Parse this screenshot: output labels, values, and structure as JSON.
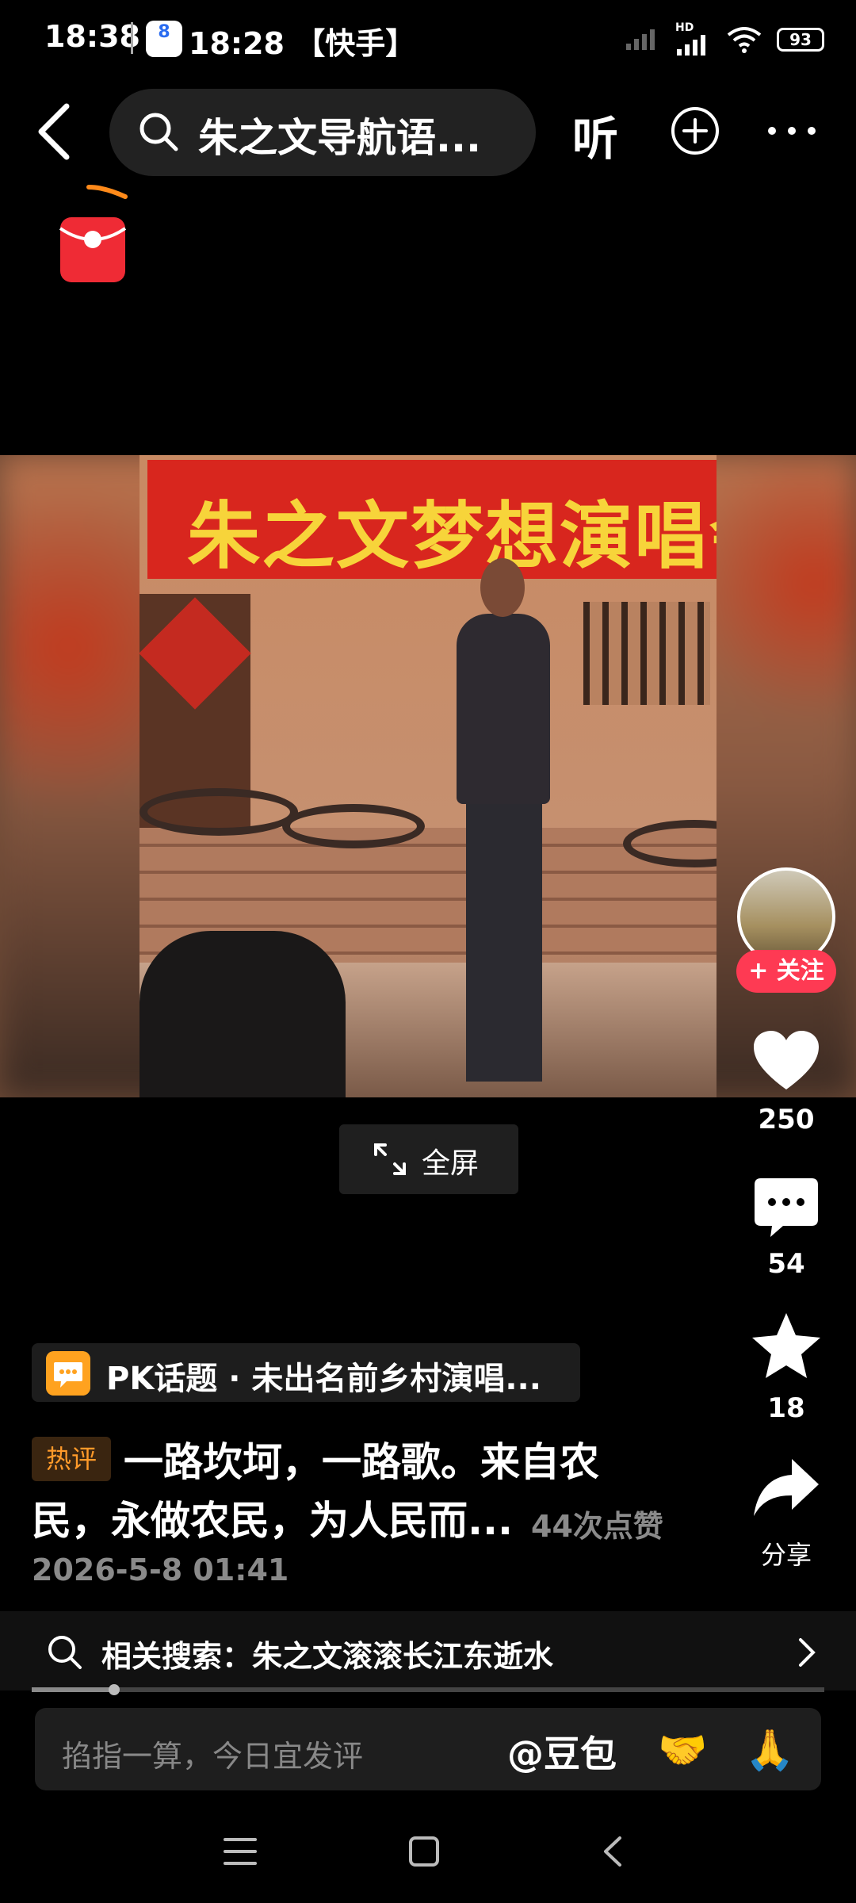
{
  "status_bar": {
    "time": "18:38",
    "app_chip_num": "8",
    "app_time_label": "18:28 【快手】",
    "network": "HD",
    "battery": "93"
  },
  "header": {
    "search_text": "朱之文导航语...",
    "listen_label": "听"
  },
  "video": {
    "banner_text": "朱之文梦想演唱会",
    "fullscreen_label": "全屏"
  },
  "rail": {
    "follow_label": "+ 关注",
    "like_count": "250",
    "comment_count": "54",
    "star_count": "18",
    "share_label": "分享"
  },
  "content": {
    "topic_text": "PK话题 · 未出名前乡村演唱...",
    "hot_badge": "热评",
    "comment_line1": "一路坎坷，一路歌。来自农",
    "comment_line2": "民，永做农民，为人民而...",
    "likes_text": "44次点赞",
    "date": "2026-5-8 01:41"
  },
  "related": {
    "text": "相关搜索：朱之文滚滚长江东逝水"
  },
  "progress": {
    "fraction": 0.104
  },
  "comment_box": {
    "placeholder": "掐指一算，今日宜发评",
    "mention": "@豆包",
    "emoji_1": "🤝",
    "emoji_2": "🙏"
  },
  "colors": {
    "follow": "#fe3a53",
    "hot_badge_text": "#ff9a2a",
    "topic_icon": "#ffa21f",
    "banner": "#d8261e"
  }
}
